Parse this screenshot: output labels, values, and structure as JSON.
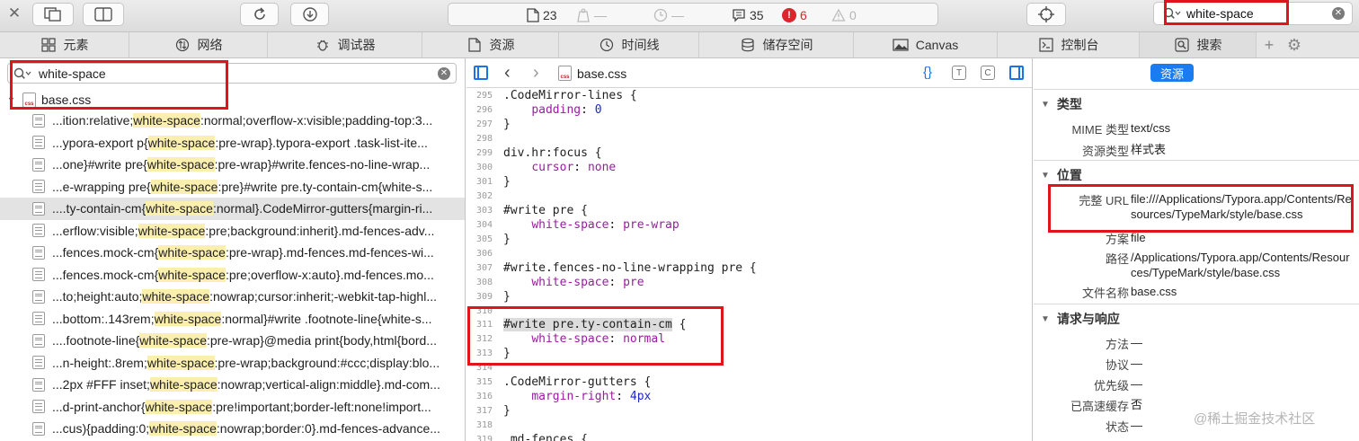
{
  "toolbar": {
    "resource_count": "23",
    "network_dim": "—",
    "time_dim": "—",
    "log_count": "35",
    "error_count": "6",
    "warning_count": "0",
    "search_value": "white-space",
    "clear_glyph": "✕"
  },
  "tabs": [
    {
      "label": "元素",
      "icon": "elements-icon"
    },
    {
      "label": "网络",
      "icon": "network-icon"
    },
    {
      "label": "调试器",
      "icon": "debugger-icon"
    },
    {
      "label": "资源",
      "icon": "resources-icon"
    },
    {
      "label": "时间线",
      "icon": "timeline-icon"
    },
    {
      "label": "储存空间",
      "icon": "storage-icon"
    },
    {
      "label": "Canvas",
      "icon": "canvas-icon"
    },
    {
      "label": "控制台",
      "icon": "console-icon"
    },
    {
      "label": "搜索",
      "icon": "search-icon"
    }
  ],
  "left": {
    "search_value": "white-space",
    "file_name": "base.css",
    "file_icon_text": "css",
    "results": [
      {
        "pre": "...ition:relative;",
        "hl": "white-space",
        "post": ":normal;overflow-x:visible;padding-top:3..."
      },
      {
        "pre": "...ypora-export p{",
        "hl": "white-space",
        "post": ":pre-wrap}.typora-export .task-list-ite..."
      },
      {
        "pre": "...one}#write pre{",
        "hl": "white-space",
        "post": ":pre-wrap}#write.fences-no-line-wrap..."
      },
      {
        "pre": "...e-wrapping pre{",
        "hl": "white-space",
        "post": ":pre}#write pre.ty-contain-cm{white-s..."
      },
      {
        "pre": "....ty-contain-cm{",
        "hl": "white-space",
        "post": ":normal}.CodeMirror-gutters{margin-ri..."
      },
      {
        "pre": "...erflow:visible;",
        "hl": "white-space",
        "post": ":pre;background:inherit}.md-fences-adv..."
      },
      {
        "pre": "...fences.mock-cm{",
        "hl": "white-space",
        "post": ":pre-wrap}.md-fences.md-fences-wi..."
      },
      {
        "pre": "...fences.mock-cm{",
        "hl": "white-space",
        "post": ":pre;overflow-x:auto}.md-fences.mo..."
      },
      {
        "pre": "...to;height:auto;",
        "hl": "white-space",
        "post": ":nowrap;cursor:inherit;-webkit-tap-highl..."
      },
      {
        "pre": "...bottom:.143rem;",
        "hl": "white-space",
        "post": ":normal}#write .footnote-line{white-s..."
      },
      {
        "pre": "....footnote-line{",
        "hl": "white-space",
        "post": ":pre-wrap}@media print{body,html{bord..."
      },
      {
        "pre": "...n-height:.8rem;",
        "hl": "white-space",
        "post": ":pre-wrap;background:#ccc;display:blo..."
      },
      {
        "pre": "...2px #FFF inset;",
        "hl": "white-space",
        "post": ":nowrap;vertical-align:middle}.md-com..."
      },
      {
        "pre": "...d-print-anchor{",
        "hl": "white-space",
        "post": ":pre!important;border-left:none!import..."
      },
      {
        "pre": "...cus){padding:0;",
        "hl": "white-space",
        "post": ":nowrap;border:0}.md-fences-advance..."
      }
    ]
  },
  "editor": {
    "file_name": "base.css",
    "file_icon_text": "css",
    "toolbar_icons": {
      "format": "{}",
      "type": "T",
      "compare": "C"
    },
    "lines": [
      {
        "n": "295",
        "parts": [
          {
            "t": ".CodeMirror-lines {",
            "c": ""
          }
        ]
      },
      {
        "n": "296",
        "parts": [
          {
            "t": "    ",
            "c": ""
          },
          {
            "t": "padding",
            "c": "prop"
          },
          {
            "t": ": ",
            "c": ""
          },
          {
            "t": "0",
            "c": "num"
          }
        ]
      },
      {
        "n": "297",
        "parts": [
          {
            "t": "}",
            "c": ""
          }
        ]
      },
      {
        "n": "298",
        "parts": []
      },
      {
        "n": "299",
        "parts": [
          {
            "t": "div.hr:focus {",
            "c": ""
          }
        ]
      },
      {
        "n": "300",
        "parts": [
          {
            "t": "    ",
            "c": ""
          },
          {
            "t": "cursor",
            "c": "prop"
          },
          {
            "t": ": ",
            "c": ""
          },
          {
            "t": "none",
            "c": "val"
          }
        ]
      },
      {
        "n": "301",
        "parts": [
          {
            "t": "}",
            "c": ""
          }
        ]
      },
      {
        "n": "302",
        "parts": []
      },
      {
        "n": "303",
        "parts": [
          {
            "t": "#write pre {",
            "c": ""
          }
        ]
      },
      {
        "n": "304",
        "parts": [
          {
            "t": "    ",
            "c": ""
          },
          {
            "t": "white-space",
            "c": "prop"
          },
          {
            "t": ": ",
            "c": ""
          },
          {
            "t": "pre-wrap",
            "c": "val"
          }
        ]
      },
      {
        "n": "305",
        "parts": [
          {
            "t": "}",
            "c": ""
          }
        ]
      },
      {
        "n": "306",
        "parts": []
      },
      {
        "n": "307",
        "parts": [
          {
            "t": "#write.fences-no-line-wrapping pre {",
            "c": ""
          }
        ]
      },
      {
        "n": "308",
        "parts": [
          {
            "t": "    ",
            "c": ""
          },
          {
            "t": "white-space",
            "c": "prop"
          },
          {
            "t": ": ",
            "c": ""
          },
          {
            "t": "pre",
            "c": "val"
          }
        ]
      },
      {
        "n": "309",
        "parts": [
          {
            "t": "}",
            "c": ""
          }
        ]
      },
      {
        "n": "310",
        "parts": []
      },
      {
        "n": "311",
        "parts": [
          {
            "t": "#write pre.ty-contain-cm",
            "c": "selected"
          },
          {
            "t": " {",
            "c": ""
          }
        ]
      },
      {
        "n": "312",
        "parts": [
          {
            "t": "    ",
            "c": ""
          },
          {
            "t": "white-space",
            "c": "prop"
          },
          {
            "t": ": ",
            "c": ""
          },
          {
            "t": "normal",
            "c": "val"
          }
        ]
      },
      {
        "n": "313",
        "parts": [
          {
            "t": "}",
            "c": ""
          }
        ]
      },
      {
        "n": "314",
        "parts": []
      },
      {
        "n": "315",
        "parts": [
          {
            "t": ".CodeMirror-gutters {",
            "c": ""
          }
        ]
      },
      {
        "n": "316",
        "parts": [
          {
            "t": "    ",
            "c": ""
          },
          {
            "t": "margin-right",
            "c": "prop"
          },
          {
            "t": ": ",
            "c": ""
          },
          {
            "t": "4px",
            "c": "num"
          }
        ]
      },
      {
        "n": "317",
        "parts": [
          {
            "t": "}",
            "c": ""
          }
        ]
      },
      {
        "n": "318",
        "parts": []
      },
      {
        "n": "319",
        "parts": [
          {
            "t": ".md-fences {",
            "c": ""
          }
        ]
      }
    ]
  },
  "details": {
    "scope_button": "资源",
    "sections": {
      "type": "类型",
      "location": "位置",
      "request": "请求与响应"
    },
    "type_rows": [
      {
        "k": "MIME 类型",
        "v": "text/css"
      },
      {
        "k": "资源类型",
        "v": "样式表"
      }
    ],
    "location_rows": [
      {
        "k": "完整 URL",
        "v": "file:///Applications/Typora.app/Contents/Resources/TypeMark/style/base.css"
      },
      {
        "k": "方案",
        "v": "file"
      },
      {
        "k": "路径",
        "v": "/Applications/Typora.app/Contents/Resources/TypeMark/style/base.css"
      },
      {
        "k": "文件名称",
        "v": "base.css"
      }
    ],
    "request_rows": [
      {
        "k": "方法",
        "v": "—"
      },
      {
        "k": "协议",
        "v": "—"
      },
      {
        "k": "优先级",
        "v": "—"
      },
      {
        "k": "已高速缓存",
        "v": "否"
      },
      {
        "k": "状态",
        "v": "—"
      }
    ]
  },
  "watermark": "@稀土掘金技术社区",
  "colors": {
    "accent": "#1b7bf0",
    "annotation_red": "#e0141b",
    "highlight": "#fbefb0",
    "error": "#d8262c"
  }
}
